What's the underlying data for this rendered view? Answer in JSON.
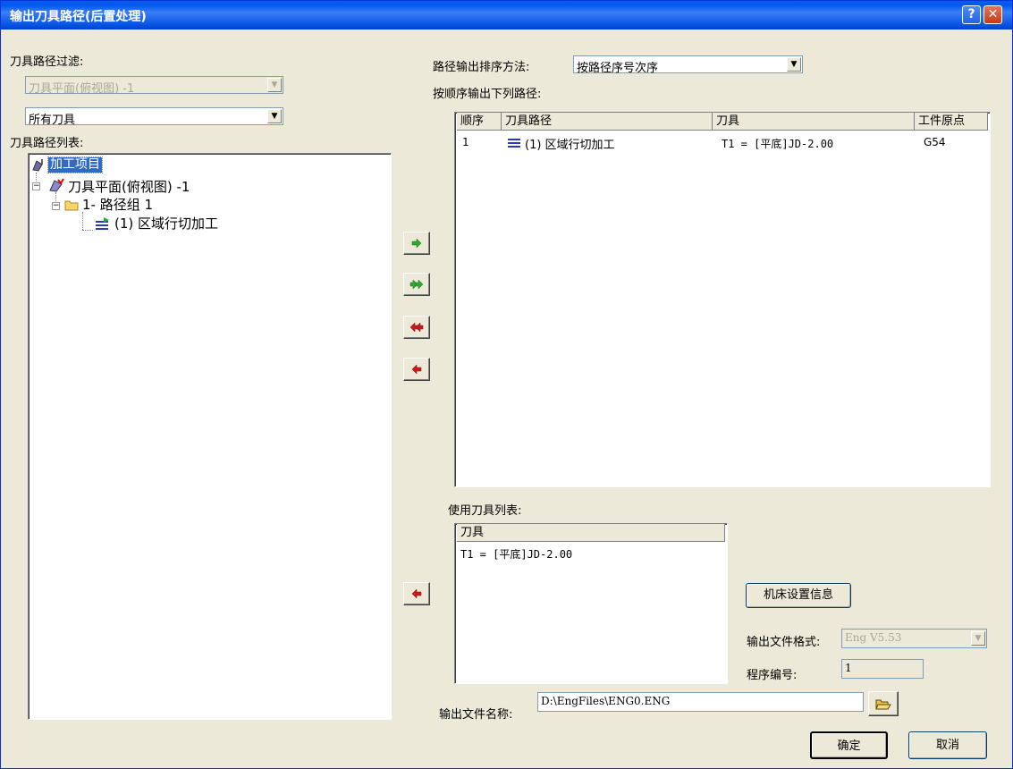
{
  "window": {
    "title": "输出刀具路径(后置处理)",
    "help_label": "?",
    "close_label": "✕"
  },
  "left": {
    "filter_label": "刀具路径过滤:",
    "filter_plane": "刀具平面(俯视图) -1",
    "filter_tools": "所有刀具",
    "list_label": "刀具路径列表:",
    "tree": {
      "root": "加工项目",
      "plane": "刀具平面(俯视图) -1",
      "group": "1- 路径组 1",
      "path": "(1) 区域行切加工"
    }
  },
  "right": {
    "sort_label": "路径输出排序方法:",
    "sort_value": "按路径序号次序",
    "output_label": "按顺序输出下列路径:",
    "output_table": {
      "headers": [
        "顺序",
        "刀具路径",
        "刀具",
        "工件原点"
      ],
      "rows": [
        {
          "order": "1",
          "path": "(1) 区域行切加工",
          "tool": "T1 = [平底]JD-2.00",
          "origin": "G54"
        }
      ]
    },
    "tools_label": "使用刀具列表:",
    "tools_table": {
      "header": "刀具",
      "rows": [
        "T1 = [平底]JD-2.00"
      ]
    },
    "machine_button": "机床设置信息",
    "format_label": "输出文件格式:",
    "format_value": "Eng V5.53",
    "program_label": "程序编号:",
    "program_value": "1",
    "filename_label": "输出文件名称:",
    "filename_value": "D:\\EngFiles\\ENG0.ENG",
    "ok_button": "确定",
    "cancel_button": "取消"
  },
  "colors": {
    "titlebar": "#0054e3",
    "selection": "#316ac5",
    "add_arrow": "#2ea82e",
    "remove_arrow": "#cc1a1a"
  }
}
